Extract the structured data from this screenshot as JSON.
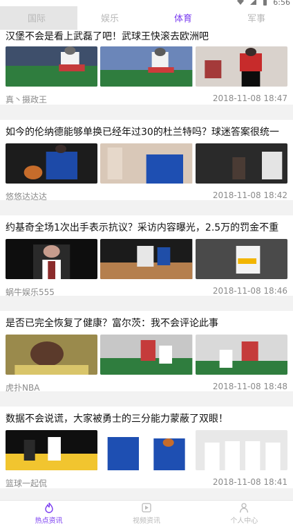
{
  "status_bar": {
    "time": "6:56",
    "icons": [
      "wifi-icon",
      "signal-icon",
      "battery-icon"
    ]
  },
  "tabs": [
    {
      "label": "国际",
      "active": false
    },
    {
      "label": "娱乐",
      "active": false
    },
    {
      "label": "体育",
      "active": true
    },
    {
      "label": "军事",
      "active": false
    }
  ],
  "colors": {
    "accent": "#7a3cf0",
    "tab_inactive": "#b8b8b8",
    "meta": "#8a8a8a"
  },
  "articles": [
    {
      "title": "汉堡不会是看上武磊了吧！武球王快滚去欧洲吧",
      "source": "真丶摄政王",
      "time": "2018-11-08 18:47"
    },
    {
      "title": "如今的伦纳德能够单换已经年过30的杜兰特吗？球迷答案很统一",
      "source": "悠悠达达达",
      "time": "2018-11-08 18:42"
    },
    {
      "title": "约基奇全场1次出手表示抗议？采访内容曝光，2.5万的罚金不重",
      "source": "蜗牛娱乐555",
      "time": "2018-11-08 18:46"
    },
    {
      "title": "是否已完全恢复了健康？富尔茨：我不会评论此事",
      "source": "虎扑NBA",
      "time": "2018-11-08 18:48"
    },
    {
      "title": "数据不会说谎，大家被勇士的三分能力蒙蔽了双眼！",
      "source": "篮球一起侃",
      "time": "2018-11-08 18:41"
    }
  ],
  "bottom_nav": [
    {
      "label": "热点资讯",
      "icon": "flame-icon",
      "active": true
    },
    {
      "label": "视频资讯",
      "icon": "video-icon",
      "active": false
    },
    {
      "label": "个人中心",
      "icon": "person-icon",
      "active": false
    }
  ]
}
